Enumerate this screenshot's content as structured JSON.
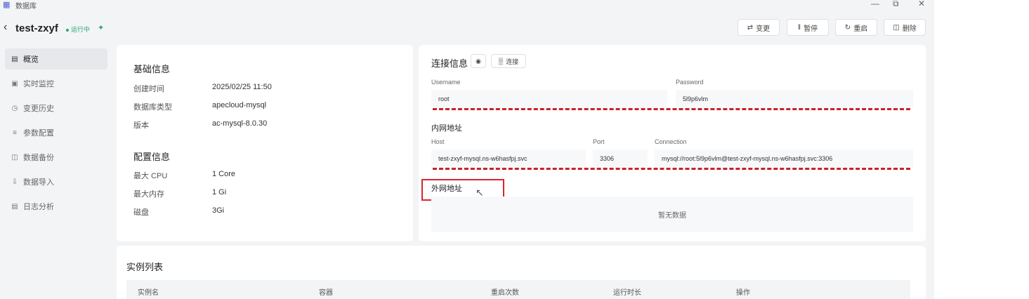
{
  "window": {
    "title": "数据库",
    "db_icon": "database-icon"
  },
  "header": {
    "name": "test-zxyf",
    "status": "运行中",
    "buttons": {
      "change": "变更",
      "pause": "暂停",
      "restart": "重启",
      "delete": "删除"
    }
  },
  "sidebar": {
    "items": [
      {
        "label": "概览",
        "icon": "overview-icon"
      },
      {
        "label": "实时监控",
        "icon": "monitor-icon"
      },
      {
        "label": "变更历史",
        "icon": "history-icon"
      },
      {
        "label": "参数配置",
        "icon": "settings-icon"
      },
      {
        "label": "数据备份",
        "icon": "backup-icon"
      },
      {
        "label": "数据导入",
        "icon": "import-icon"
      },
      {
        "label": "日志分析",
        "icon": "log-icon"
      }
    ]
  },
  "basic": {
    "title": "基础信息",
    "rows": [
      {
        "label": "创建时间",
        "value": "2025/02/25 11:50"
      },
      {
        "label": "数据库类型",
        "value": "apecloud-mysql"
      },
      {
        "label": "版本",
        "value": "ac-mysql-8.0.30"
      }
    ]
  },
  "config": {
    "title": "配置信息",
    "rows": [
      {
        "label": "最大 CPU",
        "value": "1 Core"
      },
      {
        "label": "最大内存",
        "value": "1 Gi"
      },
      {
        "label": "磁盘",
        "value": "3Gi"
      }
    ]
  },
  "connection": {
    "title": "连接信息",
    "connect_label": "连接",
    "username_label": "Username",
    "username": "root",
    "password_label": "Password",
    "password": "5l9p6vlm",
    "internal_title": "内网地址",
    "host_label": "Host",
    "host": "test-zxyf-mysql.ns-w6hasfpj.svc",
    "port_label": "Port",
    "port": "3306",
    "conn_label": "Connection",
    "conn": "mysql://root:5l9p6vlm@test-zxyf-mysql.ns-w6hasfpj.svc:3306",
    "external_title": "外网地址",
    "empty": "暂无数据"
  },
  "instances": {
    "title": "实例列表",
    "columns": [
      "实例名",
      "容器",
      "重启次数",
      "运行时长",
      "操作"
    ]
  },
  "colors": {
    "accent": "#2ba471",
    "annotation": "#d9262c",
    "dash": "#c7222a"
  }
}
